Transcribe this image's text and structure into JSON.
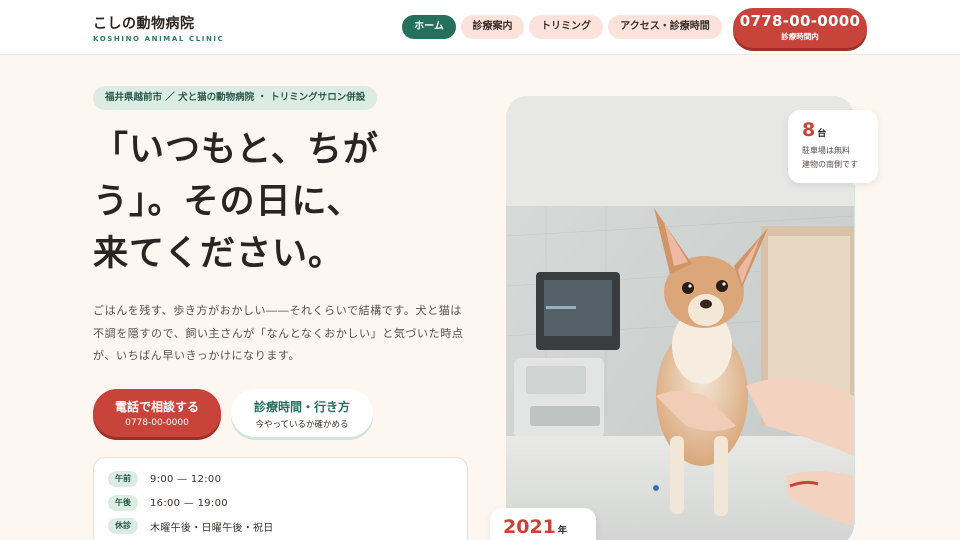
{
  "header": {
    "logo_jp": "こしの動物病院",
    "logo_en": "KOSHINO ANIMAL CLINIC",
    "nav": [
      "ホーム",
      "診療案内",
      "トリミング",
      "アクセス・診療時間"
    ],
    "phone": {
      "number": "0778-00-0000",
      "caption": "診療時間内"
    }
  },
  "hero": {
    "tagline": "福井県越前市 ／ 犬と猫の動物病院 ・ トリミングサロン併設",
    "headline": [
      "「いつもと、ちが",
      "う」。その日に、",
      "来てください。"
    ],
    "lead": [
      "ごはんを残す、歩き方がおかしい――それくらいで結構です。犬と猫は",
      "不調を隠すので、飼い主さんが「なんとなくおかしい」と気づいた時点",
      "が、いちばん早いきっかけになります。"
    ],
    "cta_call": {
      "label": "電話で相談する",
      "sub": "0778-00-0000"
    },
    "cta_hours": {
      "label": "診療時間・行き方",
      "sub": "今やっているか確かめる"
    }
  },
  "hours": [
    {
      "tag": "午前",
      "value": "9:00 — 12:00"
    },
    {
      "tag": "午後",
      "value": "16:00 — 19:00"
    },
    {
      "tag": "休診",
      "value": "木曜午後・日曜午後・祝日"
    }
  ],
  "parking": {
    "number": "8",
    "unit": "台",
    "line1": "駐車場は無料",
    "line2": "建物の南側です"
  },
  "since": {
    "number": "2021",
    "unit": "年"
  },
  "colors": {
    "brand_green": "#25705c",
    "accent_red": "#c8443a",
    "background": "#fdf6f1",
    "pill_pink": "#fbe3dc",
    "pill_green": "#dcece4"
  }
}
